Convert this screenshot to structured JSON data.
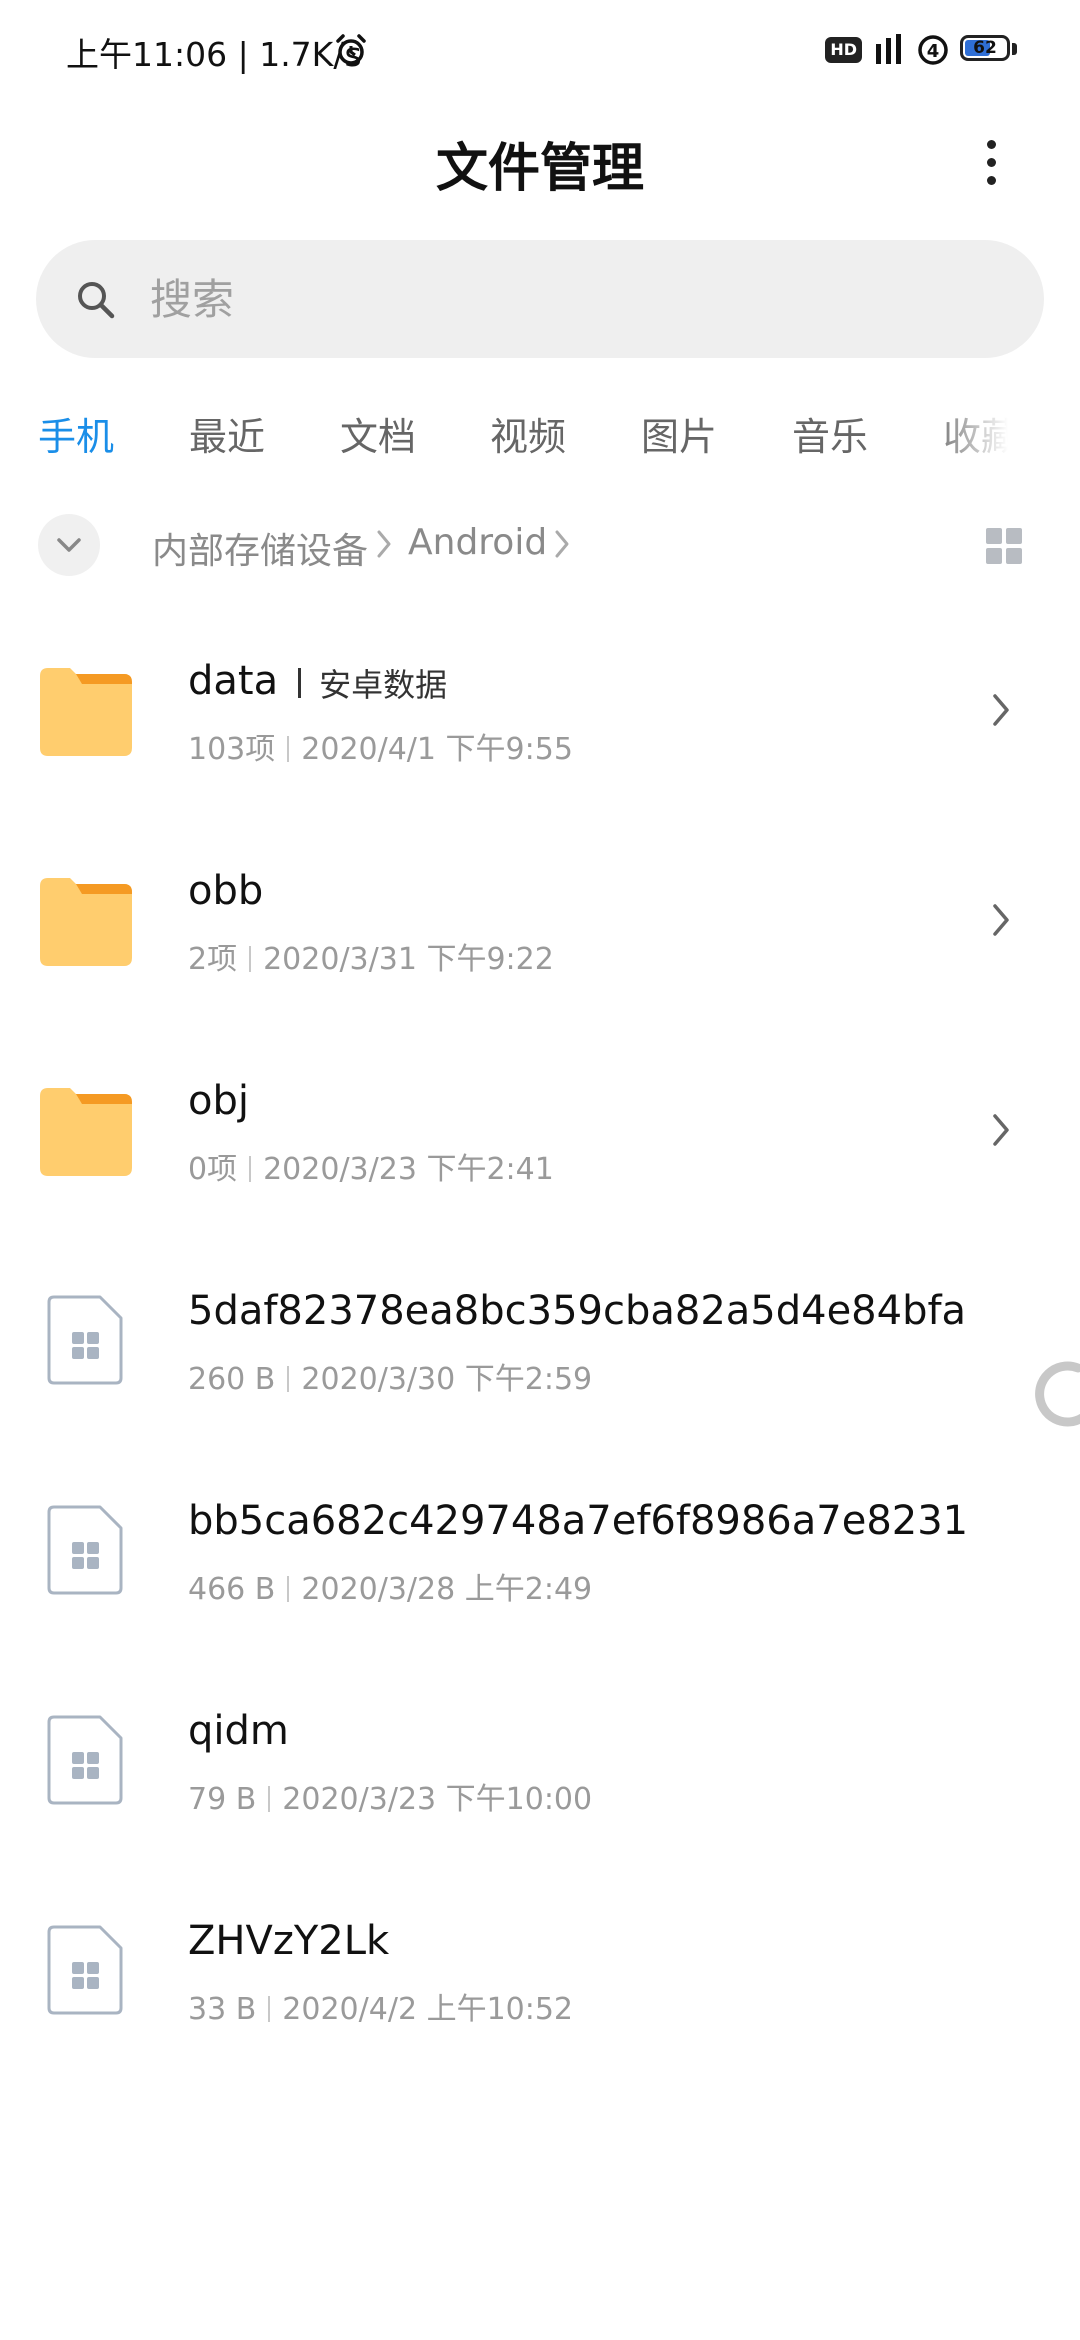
{
  "status_bar": {
    "time_text": "上午11:06 | 1.7K/s",
    "hd_badge": "HD",
    "battery_level": "62",
    "battery_fraction": 0.62
  },
  "header": {
    "title": "文件管理"
  },
  "search": {
    "placeholder": "搜索"
  },
  "tabs": [
    {
      "label": "手机",
      "active": true
    },
    {
      "label": "最近"
    },
    {
      "label": "文档"
    },
    {
      "label": "视频"
    },
    {
      "label": "图片"
    },
    {
      "label": "音乐"
    },
    {
      "label": "收藏"
    }
  ],
  "breadcrumb": {
    "items": [
      "内部存储设备",
      "Android"
    ]
  },
  "files": [
    {
      "type": "folder",
      "name": "data",
      "tag": "安卓数据",
      "info": "103项",
      "date": "2020/4/1 下午9:55"
    },
    {
      "type": "folder",
      "name": "obb",
      "info": "2项",
      "date": "2020/3/31 下午9:22"
    },
    {
      "type": "folder",
      "name": "obj",
      "info": "0项",
      "date": "2020/3/23 下午2:41"
    },
    {
      "type": "file",
      "name": "5daf82378ea8bc359cba82a5d4e84bfa",
      "info": "260 B",
      "date": "2020/3/30 下午2:59"
    },
    {
      "type": "file",
      "name": "bb5ca682c429748a7ef6f8986a7e8231",
      "info": "466 B",
      "date": "2020/3/28 上午2:49"
    },
    {
      "type": "file",
      "name": "qidm",
      "info": "79 B",
      "date": "2020/3/23 下午10:00"
    },
    {
      "type": "file",
      "name": "ZHVzY2Lk",
      "info": "33 B",
      "date": "2020/4/2 上午10:52"
    }
  ],
  "colors": {
    "accent": "#1a8ee8",
    "folder": "#ffcd6e",
    "folder_tab": "#f59a23"
  }
}
